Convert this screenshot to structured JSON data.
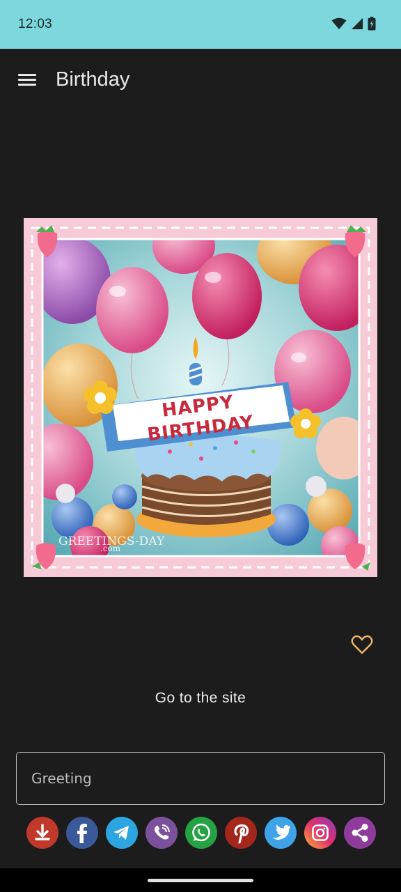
{
  "status_bar": {
    "time": "12:03",
    "icons": [
      "wifi-icon",
      "signal-icon",
      "battery-icon"
    ]
  },
  "app_bar": {
    "menu_icon": "hamburger-menu-icon",
    "title": "Birthday"
  },
  "card": {
    "banner_line1": "HAPPY",
    "banner_line2": "BIRTHDAY",
    "watermark": "GREETINGS-DAY",
    "watermark_sub": ".com"
  },
  "favorite_icon": "heart-outline-icon",
  "go_to_site_label": "Go to the site",
  "greeting_input": {
    "value": "",
    "placeholder": "Greeting"
  },
  "share_buttons": [
    {
      "name": "download",
      "icon": "download-icon",
      "color": "#c0392b"
    },
    {
      "name": "facebook",
      "icon": "facebook-icon",
      "color": "#3b5998"
    },
    {
      "name": "telegram",
      "icon": "telegram-icon",
      "color": "#2ca5e0"
    },
    {
      "name": "viber",
      "icon": "viber-icon",
      "color": "#7b519d"
    },
    {
      "name": "whatsapp",
      "icon": "whatsapp-icon",
      "color": "#25a244"
    },
    {
      "name": "pinterest",
      "icon": "pinterest-icon",
      "color": "#a3271c"
    },
    {
      "name": "twitter",
      "icon": "twitter-icon",
      "color": "#3ea3e8"
    },
    {
      "name": "instagram",
      "icon": "instagram-icon",
      "color": "#d6336c"
    },
    {
      "name": "share",
      "icon": "share-icon",
      "color": "#8e3b9c"
    }
  ],
  "colors": {
    "status_bar_bg": "#7cd8dc",
    "background": "#1c1c1c",
    "accent_heart": "#f2b66a",
    "card_frame": "#f6c9d7"
  }
}
